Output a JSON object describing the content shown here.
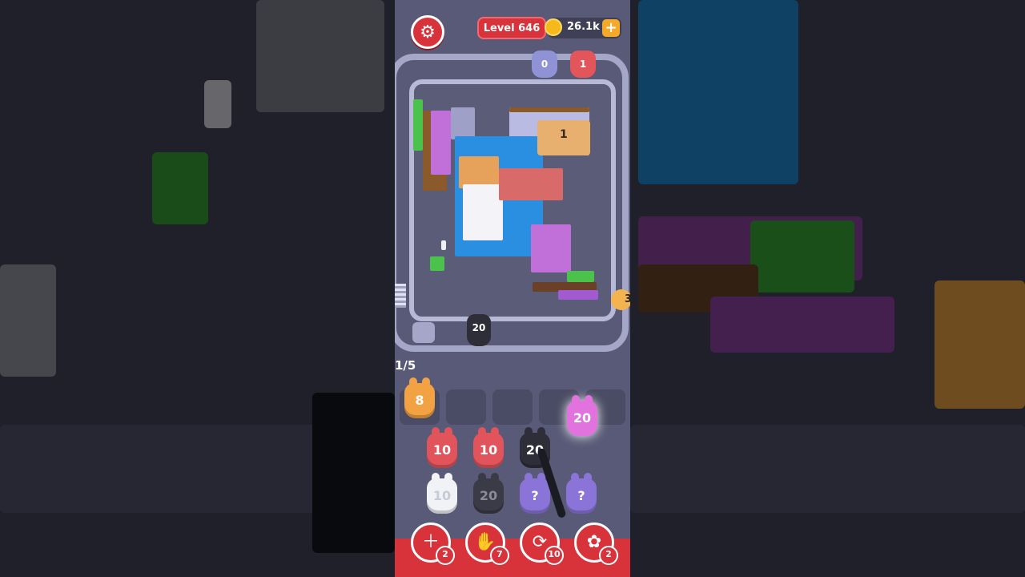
{
  "header": {
    "settings_icon": "gear-icon",
    "level_label": "Level 646",
    "coins": "26.1k",
    "coin_plus": "+"
  },
  "track": {
    "top_shooters": [
      {
        "value": "0",
        "color": "#8f93d6"
      },
      {
        "value": "1",
        "color": "#e2565b"
      }
    ],
    "active_shooter": "20",
    "right_shooter": "3",
    "plate_value": "1"
  },
  "queue": {
    "counter": "1/5",
    "slot_units": [
      {
        "value": "8",
        "color": "#f2a243"
      },
      {
        "value": "",
        "color": ""
      },
      {
        "value": "",
        "color": ""
      },
      {
        "value": "",
        "color": ""
      },
      {
        "value": "20",
        "color": "#e272dd"
      }
    ],
    "grid_row1": [
      {
        "value": "10",
        "color": "#e1545b"
      },
      {
        "value": "10",
        "color": "#e1545b"
      },
      {
        "value": "20",
        "color": "#2d2e38"
      }
    ],
    "grid_row2": [
      {
        "value": "10",
        "color": "#f1f2f6"
      },
      {
        "value": "20",
        "color": "#3a3b46"
      },
      {
        "value": "?",
        "color": "#8a74d8"
      },
      {
        "value": "?",
        "color": "#8a74d8"
      }
    ]
  },
  "boosters": [
    {
      "icon": "add-slot-icon",
      "count": "2"
    },
    {
      "icon": "hand-icon",
      "count": "7"
    },
    {
      "icon": "shuffle-icon",
      "count": "10"
    },
    {
      "icon": "bunny-icon",
      "count": "2"
    }
  ]
}
